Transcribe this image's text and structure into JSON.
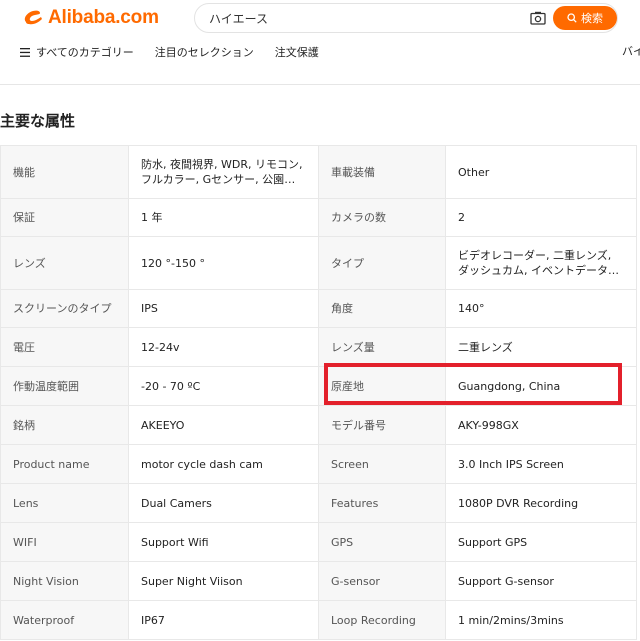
{
  "header": {
    "logo_text": "Alibaba.com",
    "brand_color": "#ff6a00",
    "search": {
      "value": "ハイエース",
      "button_label": "検索"
    },
    "nav": {
      "items": [
        "すべてのカテゴリー",
        "注目のセレクション",
        "注文保護"
      ],
      "overflow": "バイ"
    }
  },
  "section": {
    "title": "主要な属性"
  },
  "attributes": {
    "rows": [
      {
        "k1": "機能",
        "v1": "防水, 夜間視界, WDR, リモコン, フルカラー, Gセンサー, 公園モー…",
        "k2": "車載装備",
        "v2": "Other"
      },
      {
        "k1": "保証",
        "v1": "1 年",
        "k2": "カメラの数",
        "v2": "2"
      },
      {
        "k1": "レンズ",
        "v1": "120 °-150 °",
        "k2": "タイプ",
        "v2": "ビデオレコーダー, 二重レンズ, ダッシュカム, イベントデータレコ…"
      },
      {
        "k1": "スクリーンのタイプ",
        "v1": "IPS",
        "k2": "角度",
        "v2": "140°"
      },
      {
        "k1": "電圧",
        "v1": "12-24v",
        "k2": "レンズ量",
        "v2": "二重レンズ"
      },
      {
        "k1": "作動温度範囲",
        "v1": "-20 - 70 ºC",
        "k2": "原産地",
        "v2": "Guangdong, China"
      },
      {
        "k1": "銘柄",
        "v1": "AKEEYO",
        "k2": "モデル番号",
        "v2": "AKY-998GX"
      },
      {
        "k1": "Product name",
        "v1": "motor cycle dash cam",
        "k2": "Screen",
        "v2": "3.0 Inch IPS Screen"
      },
      {
        "k1": "Lens",
        "v1": "Dual Camers",
        "k2": "Features",
        "v2": "1080P DVR Recording"
      },
      {
        "k1": "WIFI",
        "v1": "Support Wifi",
        "k2": "GPS",
        "v2": "Support GPS"
      },
      {
        "k1": "Night Vision",
        "v1": "Super Night Viison",
        "k2": "G-sensor",
        "v2": "Support G-sensor"
      },
      {
        "k1": "Waterproof",
        "v1": "IP67",
        "k2": "Loop Recording",
        "v2": "1 min/2mins/3mins"
      }
    ]
  },
  "highlight_color": "#e3202b"
}
